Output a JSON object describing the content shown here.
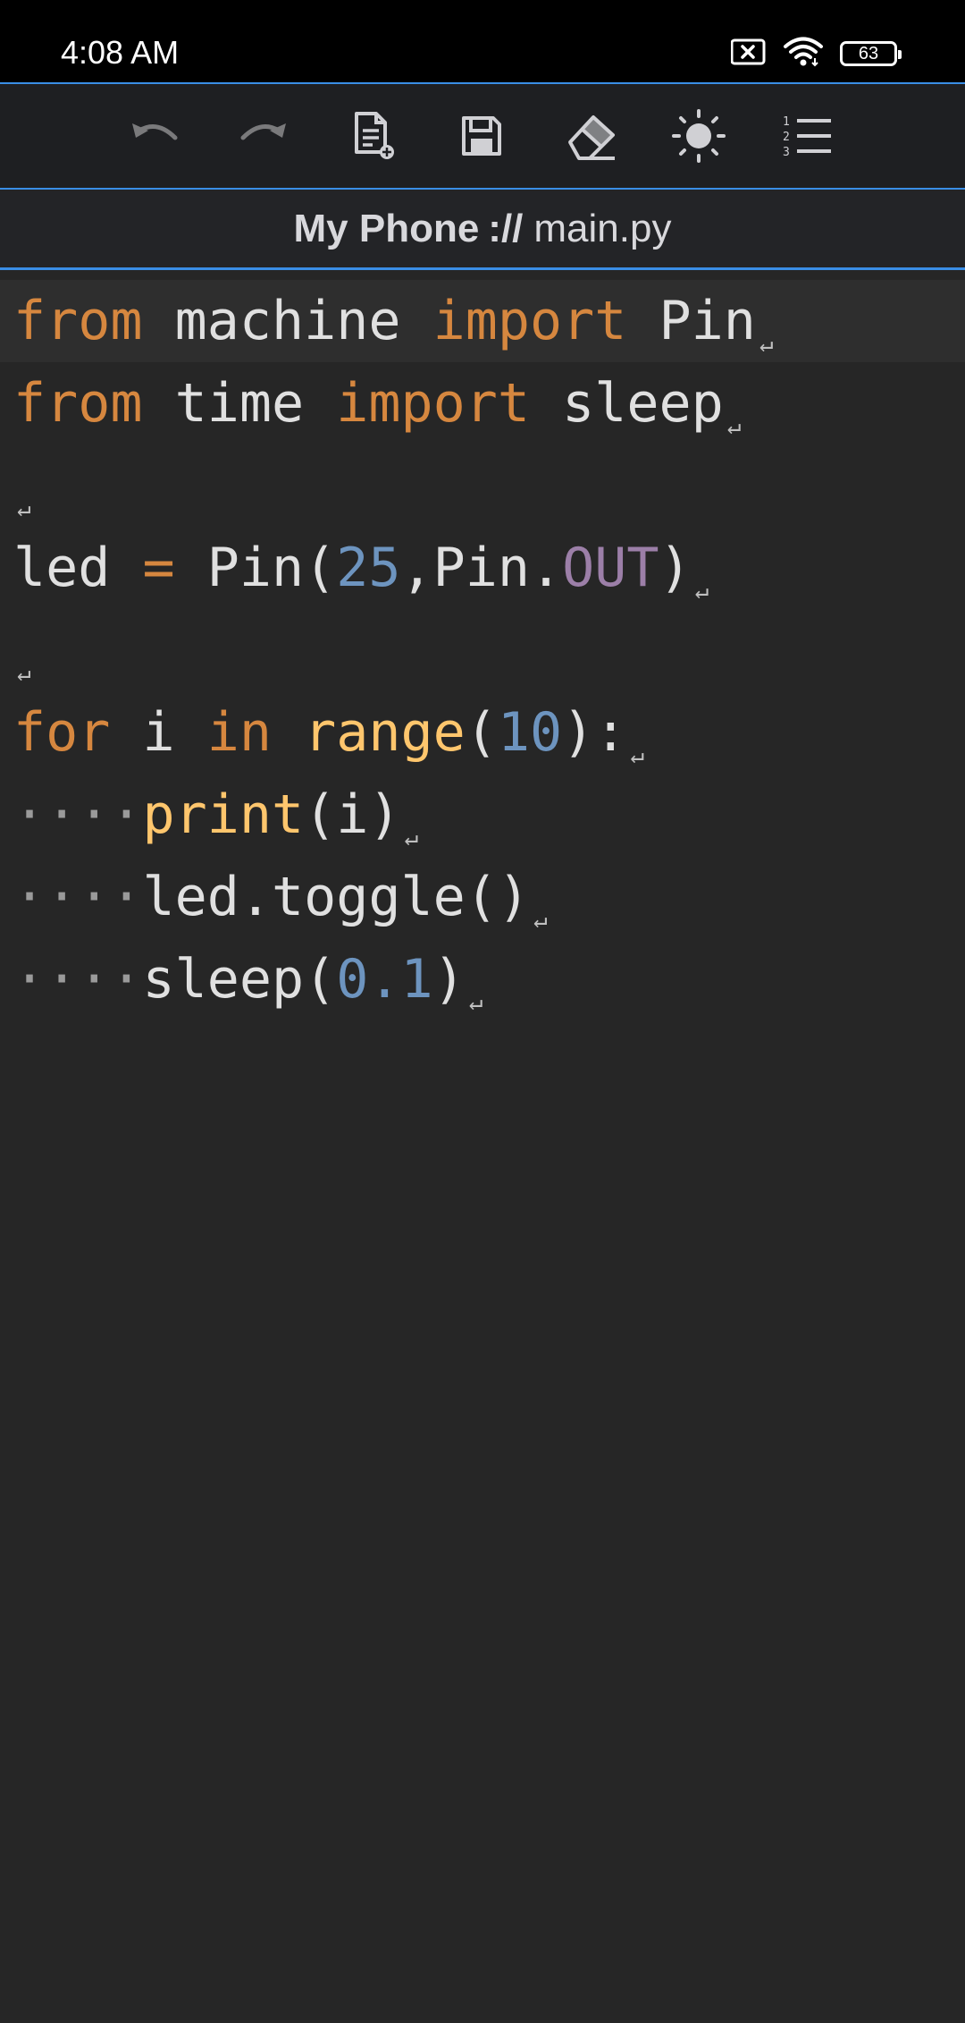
{
  "status_bar": {
    "time": "4:08 AM",
    "battery": "63",
    "icons": [
      "sim-off-icon",
      "wifi-icon",
      "battery-icon"
    ]
  },
  "toolbar": {
    "buttons": [
      "undo-icon",
      "redo-icon",
      "new-file-icon",
      "save-icon",
      "eraser-icon",
      "brightness-icon",
      "line-numbers-icon"
    ]
  },
  "path": {
    "device": "My Phone",
    "separator": "://",
    "filename": "main.py"
  },
  "editor": {
    "colors": {
      "keyword": "#d6873f",
      "function": "#ffc66d",
      "number": "#6d94bf",
      "attribute": "#9c7fa8",
      "text": "#e0e0e0",
      "background": "#262626"
    },
    "eol_marker": "↵",
    "lines": {
      "l1": {
        "kw1": "from",
        "t1": " machine ",
        "kw2": "import",
        "t2": " Pin"
      },
      "l2": {
        "kw1": "from",
        "t1": " time ",
        "kw2": "import",
        "t2": " sleep"
      },
      "l4": {
        "t1": "led ",
        "op": "=",
        "t2": " Pin(",
        "num": "25",
        "t3": ",Pin.",
        "attr": "OUT",
        "t4": ")"
      },
      "l6": {
        "kw1": "for",
        "t1": " i ",
        "kw2": "in",
        "t2": " ",
        "fn": "range",
        "t3": "(",
        "num": "10",
        "t4": "):"
      },
      "l7": {
        "ws": "····",
        "fn": "print",
        "t1": "(i)"
      },
      "l8": {
        "ws": "····",
        "t1": "led.toggle()"
      },
      "l9": {
        "ws": "····",
        "t1": "sleep(",
        "num": "0.1",
        "t2": ")"
      }
    }
  }
}
